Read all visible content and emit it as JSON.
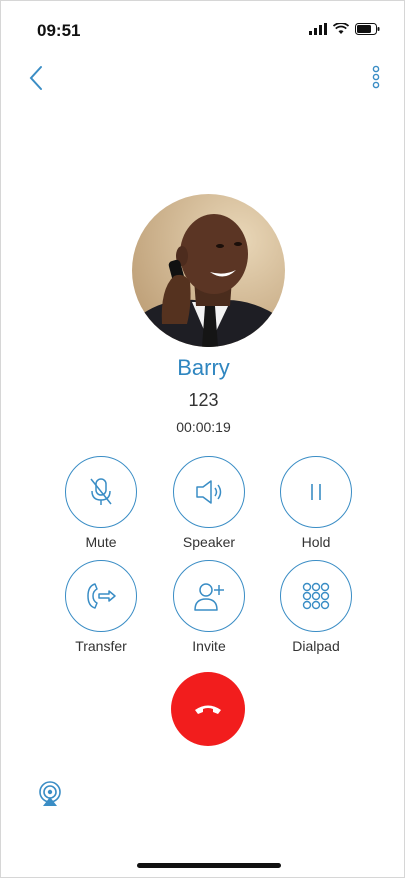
{
  "status_bar": {
    "time": "09:51"
  },
  "contact": {
    "name": "Barry",
    "number": "123",
    "duration": "00:00:19"
  },
  "controls": [
    {
      "label": "Mute",
      "icon": "mic-off-icon"
    },
    {
      "label": "Speaker",
      "icon": "speaker-icon"
    },
    {
      "label": "Hold",
      "icon": "pause-icon"
    },
    {
      "label": "Transfer",
      "icon": "transfer-call-icon"
    },
    {
      "label": "Invite",
      "icon": "add-person-icon"
    },
    {
      "label": "Dialpad",
      "icon": "dialpad-icon"
    }
  ],
  "colors": {
    "accent": "#3a8dc5",
    "name": "#2f86c0",
    "end_call": "#f21d1d"
  },
  "icons": {
    "back": "chevron-left-icon",
    "more": "more-vertical-icon",
    "end_call": "phone-hangup-icon",
    "airplay": "airplay-icon"
  }
}
